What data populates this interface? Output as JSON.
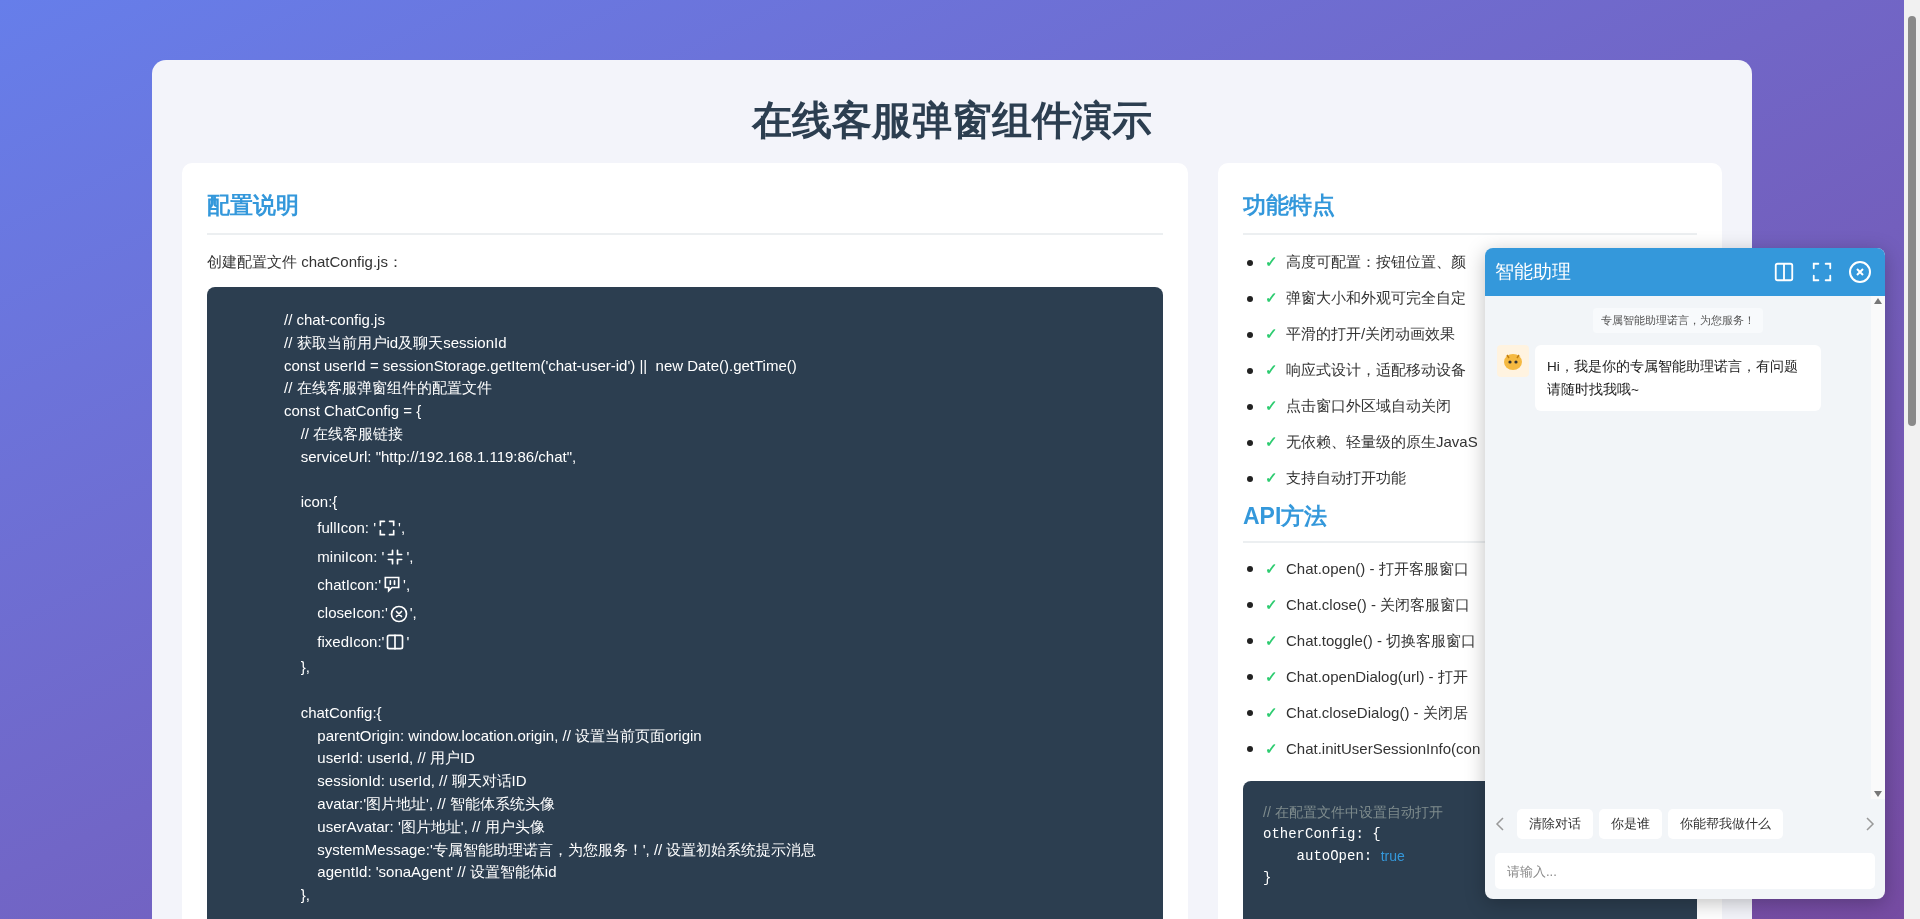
{
  "page_title": "在线客服弹窗组件演示",
  "config_card": {
    "heading": "配置说明",
    "intro": "创建配置文件 chatConfig.js：",
    "code_lines": [
      {
        "kind": "text",
        "text": "// chat-config.js"
      },
      {
        "kind": "text",
        "text": "// 获取当前用户id及聊天sessionId"
      },
      {
        "kind": "text",
        "text": "const userId = sessionStorage.getItem('chat-user-id') ||  new Date().getTime()"
      },
      {
        "kind": "text",
        "text": "// 在线客服弹窗组件的配置文件"
      },
      {
        "kind": "text",
        "text": "const ChatConfig = {"
      },
      {
        "kind": "text",
        "text": "    // 在线客服链接"
      },
      {
        "kind": "text",
        "text": "    serviceUrl: \"http://192.168.1.119:86/chat\","
      },
      {
        "kind": "blank"
      },
      {
        "kind": "text",
        "text": "    icon:{"
      },
      {
        "kind": "icon",
        "before": "        fullIcon: '",
        "after": "',"
      },
      {
        "kind": "icon",
        "before": "        miniIcon: '",
        "after": "',"
      },
      {
        "kind": "icon",
        "before": "        chatIcon:'",
        "after": "',"
      },
      {
        "kind": "icon",
        "before": "        closeIcon:'",
        "after": "',"
      },
      {
        "kind": "icon",
        "before": "        fixedIcon:'",
        "after": "'"
      },
      {
        "kind": "text",
        "text": "    },"
      },
      {
        "kind": "blank"
      },
      {
        "kind": "text",
        "text": "    chatConfig:{"
      },
      {
        "kind": "text",
        "text": "        parentOrigin: window.location.origin, // 设置当前页面origin"
      },
      {
        "kind": "text",
        "text": "        userId: userId, // 用户ID"
      },
      {
        "kind": "text",
        "text": "        sessionId: userId, // 聊天对话ID"
      },
      {
        "kind": "text",
        "text": "        avatar:'图片地址', // 智能体系统头像"
      },
      {
        "kind": "text",
        "text": "        userAvatar: '图片地址', // 用户头像"
      },
      {
        "kind": "text",
        "text": "        systemMessage:'专属智能助理诺言，为您服务！', // 设置初始系统提示消息"
      },
      {
        "kind": "text",
        "text": "        agentId: 'sonaAgent' // 设置智能体id"
      },
      {
        "kind": "text",
        "text": "    },"
      }
    ]
  },
  "features_card": {
    "heading": "功能特点",
    "features": [
      {
        "check": "✓",
        "text": "高度可配置：按钮位置、颜"
      },
      {
        "check": "✓",
        "text": "弹窗大小和外观可完全自定"
      },
      {
        "check": "✓",
        "text": "平滑的打开/关闭动画效果"
      },
      {
        "check": "✓",
        "text": "响应式设计，适配移动设备"
      },
      {
        "check": "✓",
        "text": "点击窗口外区域自动关闭"
      },
      {
        "check": "✓",
        "text": "无依赖、轻量级的原生JavaS"
      },
      {
        "check": "✓",
        "text": "支持自动打开功能"
      }
    ],
    "api_heading": "API方法",
    "api": [
      {
        "check": "✓",
        "text": "Chat.open() - 打开客服窗口"
      },
      {
        "check": "✓",
        "text": "Chat.close() - 关闭客服窗口"
      },
      {
        "check": "✓",
        "text": "Chat.toggle() - 切换客服窗口"
      },
      {
        "check": "✓",
        "text": "Chat.openDialog(url) - 打开"
      },
      {
        "check": "✓",
        "text": "Chat.closeDialog() - 关闭居"
      },
      {
        "check": "✓",
        "text": "Chat.initUserSessionInfo(con"
      }
    ],
    "code": {
      "comment": "// 在配置文件中设置自动打开",
      "line_1": "otherConfig: {",
      "key": "    autoOpen: ",
      "value": "true",
      "line_3": "}"
    }
  },
  "chat_window": {
    "title": "智能助理",
    "system_message": "专属智能助理诺言，为您服务！",
    "messages": [
      {
        "text": "Hi，我是你的专属智能助理诺言，有问题请随时找我哦~"
      }
    ],
    "quick_replies": [
      "清除对话",
      "你是谁",
      "你能帮我做什么"
    ],
    "input": {
      "placeholder": "请输入..."
    }
  }
}
